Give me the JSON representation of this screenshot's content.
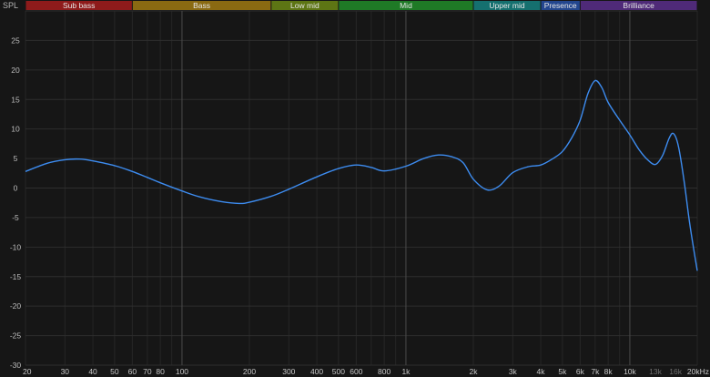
{
  "chart_data": {
    "type": "line",
    "y_axis_label": "SPL",
    "x_scale": "log",
    "xlim": [
      20,
      20000
    ],
    "ylim": [
      -30,
      30
    ],
    "y_ticks": [
      25,
      20,
      15,
      10,
      5,
      0,
      -5,
      -10,
      -15,
      -20,
      -25,
      -30
    ],
    "x_ticks": [
      {
        "value": 20,
        "label": "20"
      },
      {
        "value": 30,
        "label": "30"
      },
      {
        "value": 40,
        "label": "40"
      },
      {
        "value": 50,
        "label": "50"
      },
      {
        "value": 60,
        "label": "60"
      },
      {
        "value": 70,
        "label": "70"
      },
      {
        "value": 80,
        "label": "80"
      },
      {
        "value": 100,
        "label": "100"
      },
      {
        "value": 200,
        "label": "200"
      },
      {
        "value": 300,
        "label": "300"
      },
      {
        "value": 400,
        "label": "400"
      },
      {
        "value": 500,
        "label": "500"
      },
      {
        "value": 600,
        "label": "600"
      },
      {
        "value": 800,
        "label": "800"
      },
      {
        "value": 1000,
        "label": "1k"
      },
      {
        "value": 2000,
        "label": "2k"
      },
      {
        "value": 3000,
        "label": "3k"
      },
      {
        "value": 4000,
        "label": "4k"
      },
      {
        "value": 5000,
        "label": "5k"
      },
      {
        "value": 6000,
        "label": "6k"
      },
      {
        "value": 7000,
        "label": "7k"
      },
      {
        "value": 8000,
        "label": "8k"
      },
      {
        "value": 10000,
        "label": "10k"
      },
      {
        "value": 13000,
        "label": "13k",
        "dim": true
      },
      {
        "value": 16000,
        "label": "16k",
        "dim": true
      },
      {
        "value": 20000,
        "label": "20kHz"
      }
    ],
    "bands": [
      {
        "name": "Sub bass",
        "from": 20,
        "to": 60,
        "color": "#8e1b1b"
      },
      {
        "name": "Bass",
        "from": 60,
        "to": 250,
        "color": "#8a6a12"
      },
      {
        "name": "Low mid",
        "from": 250,
        "to": 500,
        "color": "#5d7514"
      },
      {
        "name": "Mid",
        "from": 500,
        "to": 2000,
        "color": "#1f7a26"
      },
      {
        "name": "Upper mid",
        "from": 2000,
        "to": 4000,
        "color": "#15706f"
      },
      {
        "name": "Presence",
        "from": 4000,
        "to": 6000,
        "color": "#23468e"
      },
      {
        "name": "Brilliance",
        "from": 6000,
        "to": 20000,
        "color": "#4f2a78"
      }
    ],
    "series": [
      {
        "color": "#3d8cf0",
        "points": [
          [
            20,
            2.8
          ],
          [
            25,
            4.2
          ],
          [
            30,
            4.8
          ],
          [
            35,
            4.9
          ],
          [
            40,
            4.6
          ],
          [
            50,
            3.8
          ],
          [
            60,
            2.8
          ],
          [
            70,
            1.8
          ],
          [
            80,
            0.9
          ],
          [
            100,
            -0.5
          ],
          [
            120,
            -1.5
          ],
          [
            150,
            -2.3
          ],
          [
            180,
            -2.6
          ],
          [
            200,
            -2.4
          ],
          [
            250,
            -1.4
          ],
          [
            300,
            -0.2
          ],
          [
            400,
            1.9
          ],
          [
            500,
            3.3
          ],
          [
            600,
            3.9
          ],
          [
            700,
            3.5
          ],
          [
            800,
            2.9
          ],
          [
            1000,
            3.7
          ],
          [
            1200,
            5.0
          ],
          [
            1400,
            5.6
          ],
          [
            1600,
            5.3
          ],
          [
            1800,
            4.3
          ],
          [
            2000,
            1.5
          ],
          [
            2300,
            -0.3
          ],
          [
            2600,
            0.3
          ],
          [
            3000,
            2.6
          ],
          [
            3500,
            3.6
          ],
          [
            4000,
            3.9
          ],
          [
            4500,
            4.9
          ],
          [
            5000,
            6.2
          ],
          [
            5500,
            8.5
          ],
          [
            6000,
            11.5
          ],
          [
            6500,
            16.0
          ],
          [
            7000,
            18.2
          ],
          [
            7500,
            17.0
          ],
          [
            8000,
            14.5
          ],
          [
            9000,
            11.5
          ],
          [
            10000,
            9.0
          ],
          [
            11000,
            6.5
          ],
          [
            12000,
            4.8
          ],
          [
            13000,
            4.0
          ],
          [
            14000,
            5.5
          ],
          [
            15000,
            8.5
          ],
          [
            15700,
            9.2
          ],
          [
            16500,
            7.0
          ],
          [
            17500,
            1.0
          ],
          [
            18500,
            -6.0
          ],
          [
            20000,
            -14.0
          ]
        ]
      }
    ]
  }
}
